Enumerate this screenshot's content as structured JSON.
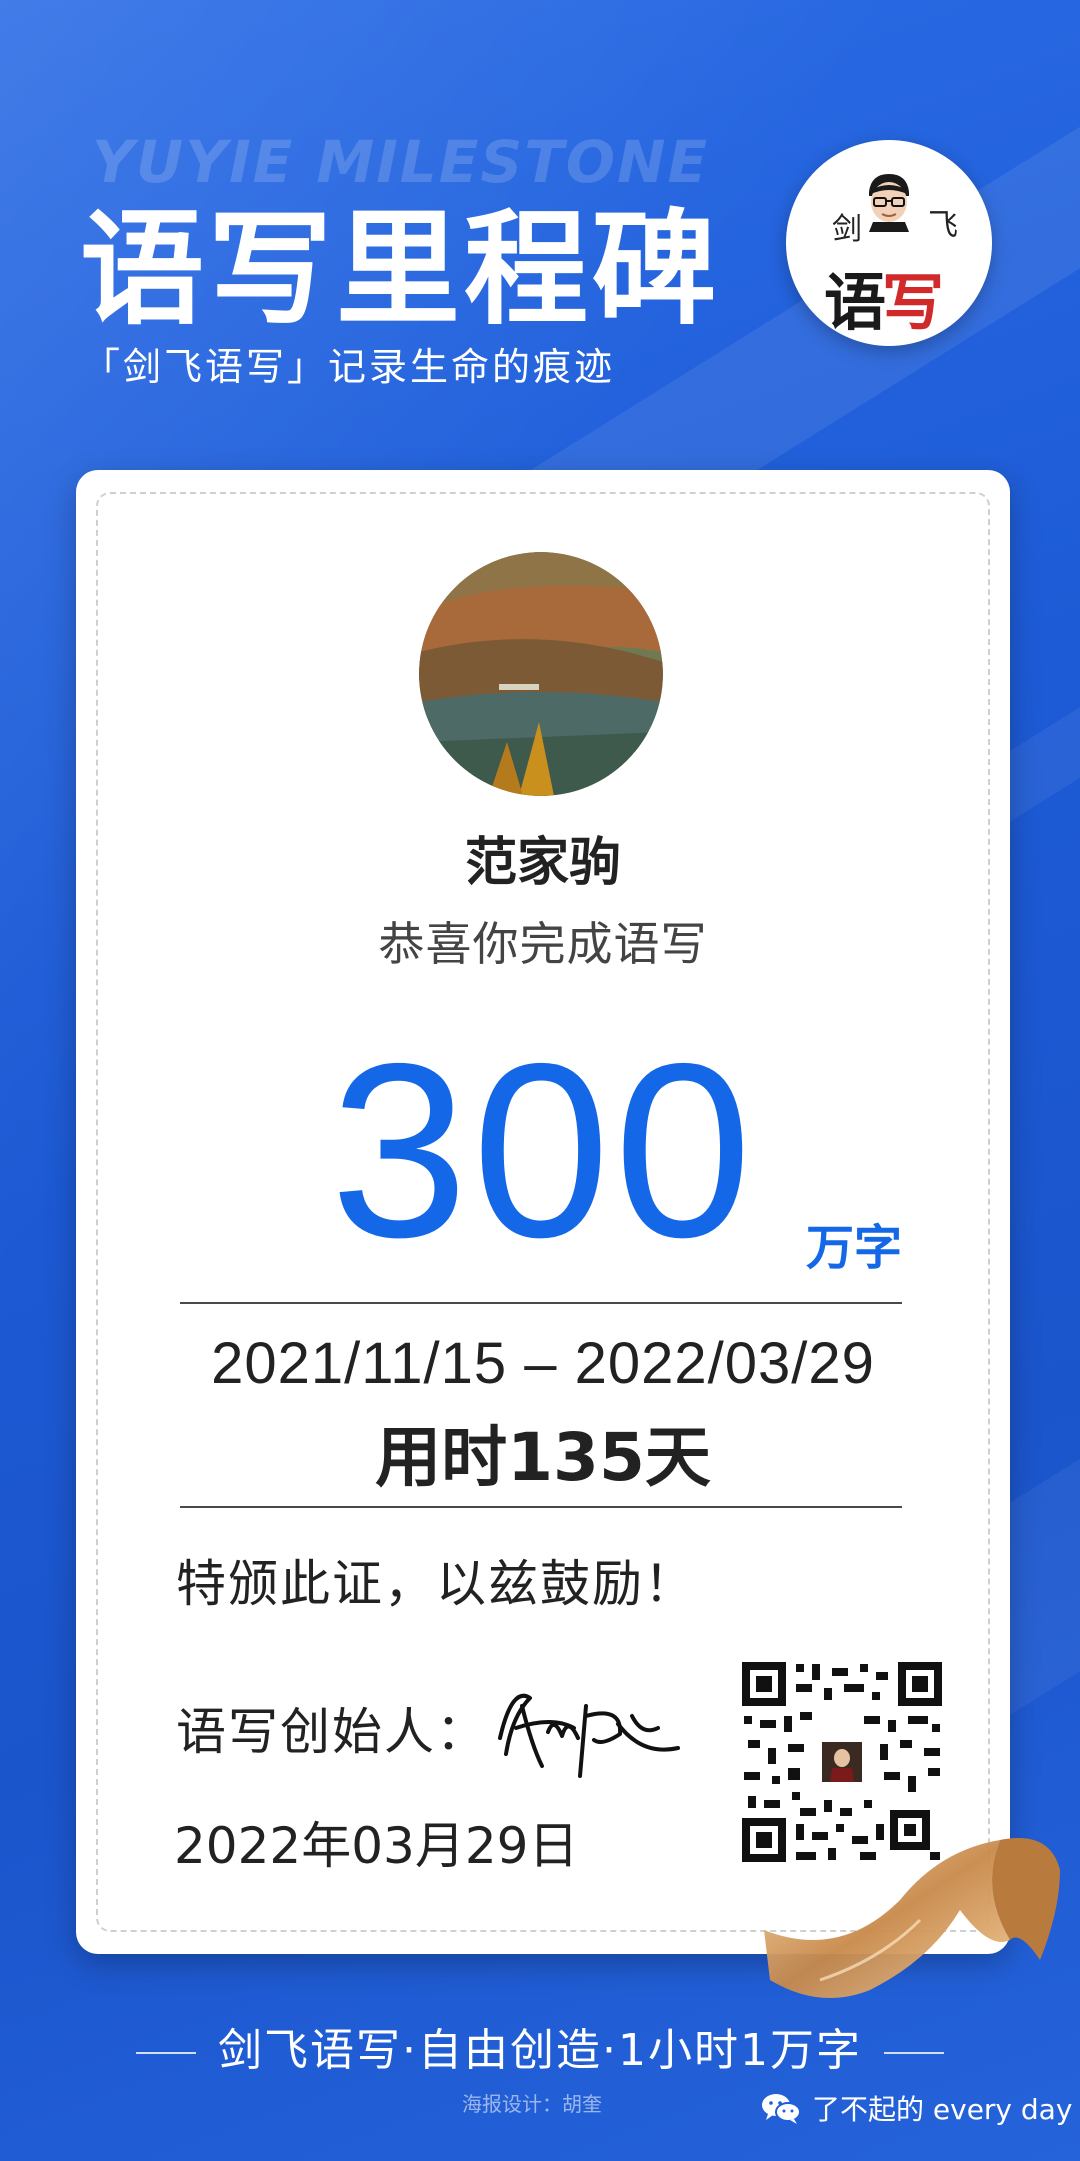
{
  "header": {
    "watermark": "YUYIE MILESTONE",
    "title": "语写里程碑",
    "subtitle": "「剑飞语写」记录生命的痕迹"
  },
  "logo": {
    "top_left": "剑",
    "top_right": "飞",
    "main_black": "语",
    "main_red": "写"
  },
  "card": {
    "username": "范家驹",
    "congrats": "恭喜你完成语写",
    "number": "300",
    "unit": "万字",
    "date_range": "2021/11/15 – 2022/03/29",
    "duration": "用时135天",
    "certificate": "特颁此证，以兹鼓励！",
    "founder_label": "语写创始人：",
    "signed_date": "2022年03月29日"
  },
  "footer": {
    "slogan": "剑飞语写·自由创造·1小时1万字",
    "credit": "海报设计：胡奎",
    "wechat": "了不起的 every day"
  },
  "colors": {
    "background": "#1f5fd8",
    "accent": "#1468e8",
    "logo_red": "#d12a2a"
  }
}
